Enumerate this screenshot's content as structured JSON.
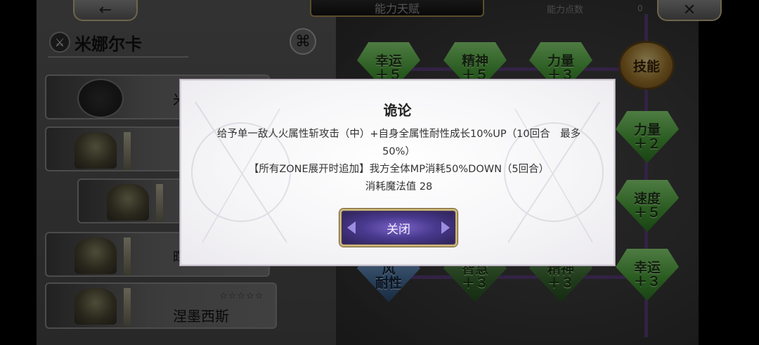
{
  "topbar": {
    "back_icon": "←",
    "close_icon": "✕",
    "title": "能力天赋",
    "points_label": "能力点数",
    "points_value": "0"
  },
  "character": {
    "weapon_icon": "sword-badge-icon",
    "name": "米娜尔卡",
    "swap_icon": "⌘"
  },
  "character_list": [
    {
      "label": "米"
    },
    {
      "label": ""
    },
    {
      "label": ""
    },
    {
      "label": "晖"
    },
    {
      "label": "涅墨西斯",
      "stars": "☆☆☆☆☆"
    }
  ],
  "talent_nodes": [
    {
      "label_top": "幸运",
      "label_bottom": "＋５"
    },
    {
      "label_top": "精神",
      "label_bottom": "＋５"
    },
    {
      "label_top": "力量",
      "label_bottom": "＋３"
    },
    {
      "label_top": "力量",
      "label_bottom": "＋２"
    },
    {
      "label_top": "速度",
      "label_bottom": "＋５"
    },
    {
      "label_top": "风",
      "label_bottom": "耐性"
    },
    {
      "label_top": "智慧",
      "label_bottom": "＋３"
    },
    {
      "label_top": "精神",
      "label_bottom": "＋３"
    },
    {
      "label_top": "幸运",
      "label_bottom": "＋３"
    }
  ],
  "skill_emblem": "技能",
  "dialog": {
    "title": "诡论",
    "line1": "给予单一敌人火属性斩攻击（中）+自身全属性耐性成长10%UP（10回合　最多50%）",
    "line2": "【所有ZONE展开时追加】我方全体MP消耗50%DOWN（5回合）",
    "line3": "消耗魔法值 28",
    "close_label": "关闭"
  },
  "colors": {
    "dialog_bg": "#f6f6f8",
    "button_purple": "#4a3a8f",
    "button_gold_border": "#c9b277",
    "gem_green": "#4ea83c",
    "gem_blue": "#4d78a8"
  }
}
